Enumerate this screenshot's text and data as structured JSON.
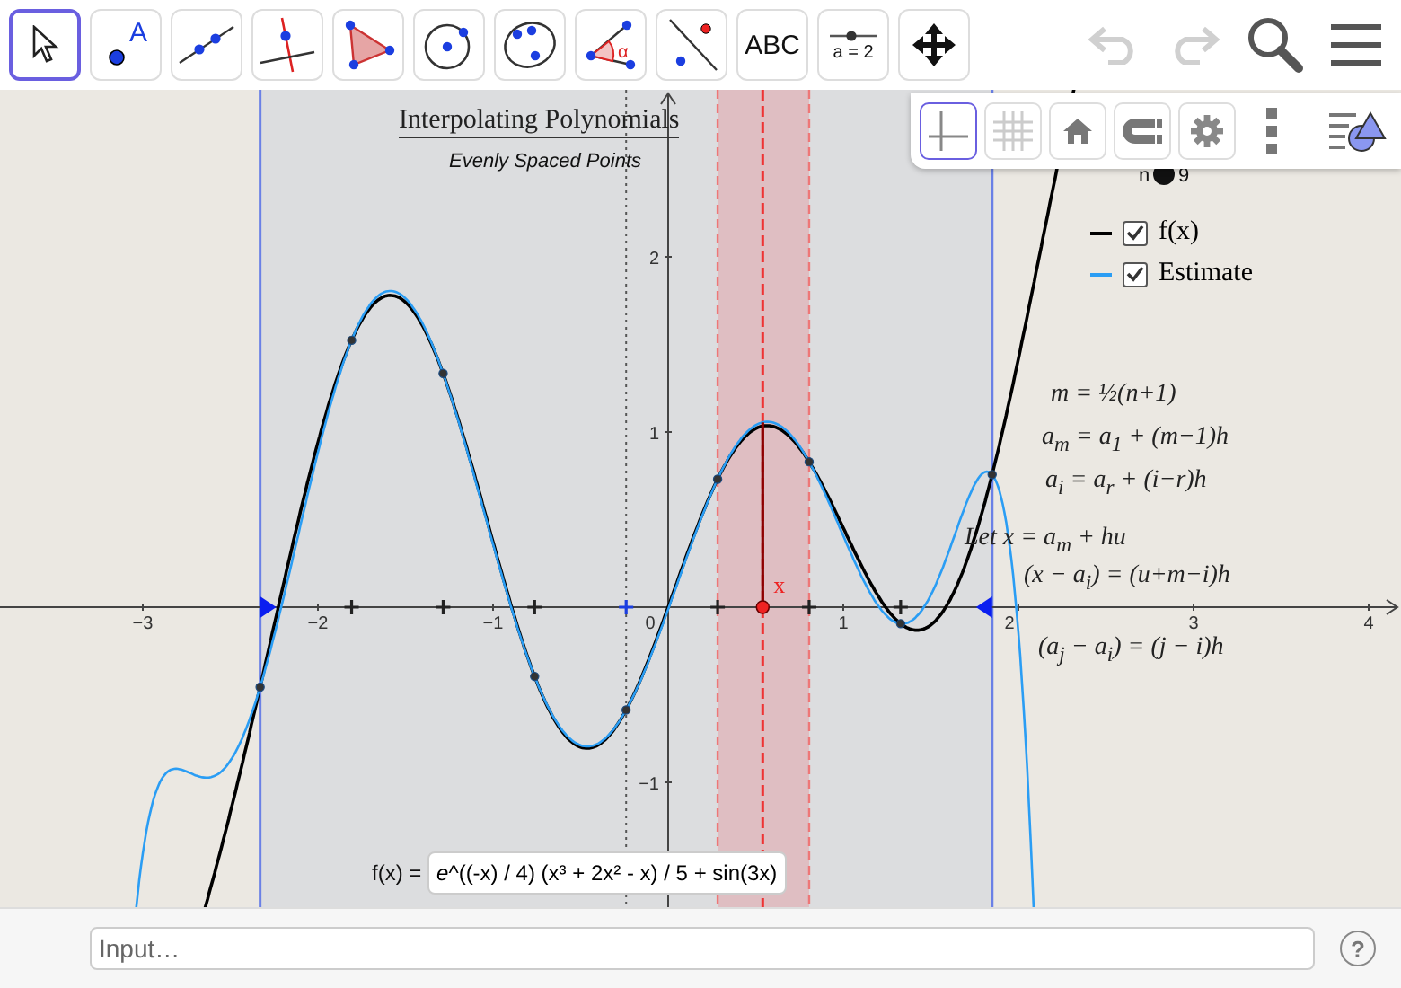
{
  "toolbar": {
    "tools": [
      {
        "kind": "move",
        "selected": true
      },
      {
        "kind": "point",
        "label": "A",
        "selected": false
      },
      {
        "kind": "line",
        "selected": false
      },
      {
        "kind": "perpendicular",
        "selected": false
      },
      {
        "kind": "polygon",
        "selected": false
      },
      {
        "kind": "circle",
        "selected": false
      },
      {
        "kind": "conic",
        "selected": false
      },
      {
        "kind": "angle",
        "label": "α",
        "selected": false
      },
      {
        "kind": "reflect",
        "selected": false
      },
      {
        "kind": "text",
        "label": "ABC",
        "selected": false
      },
      {
        "kind": "slider",
        "label": "a = 2",
        "selected": false
      },
      {
        "kind": "pan",
        "selected": false
      }
    ],
    "undo": {
      "disabled": true
    },
    "redo": {
      "disabled": true
    }
  },
  "graphics_style_bar": {
    "buttons": [
      {
        "kind": "axes",
        "on": true
      },
      {
        "kind": "grid",
        "on": false
      },
      {
        "kind": "home"
      },
      {
        "kind": "snap"
      },
      {
        "kind": "settings"
      },
      {
        "kind": "more"
      },
      {
        "kind": "style"
      }
    ]
  },
  "graphics": {
    "title": "Interpolating Polynomials",
    "subtitle": "Evenly Spaced Points",
    "slider": {
      "name": "n",
      "value": "9"
    },
    "legend": [
      {
        "label": "f(x)",
        "checked": true,
        "color": "#000000"
      },
      {
        "label": "Estimate",
        "checked": true,
        "color": "#2a9df4"
      }
    ],
    "formulas": [
      "m = ½(n+1)",
      "a$_{m}$ = a$_{1}$ + (m−1)h",
      "a$_{i}$ = a$_{r}$ + (i−r)h",
      "Let x = a$_{m}$ + hu",
      "(x − a$_{i}$) = (u+m−i)h",
      "(a$_{j}$ − a$_{i}$) = (j − i)h"
    ],
    "point_label": "x",
    "x_tick_labels": [
      "−3",
      "−2",
      "−1",
      "0",
      "1",
      "2",
      "3",
      "4"
    ],
    "y_tick_labels": [
      "2",
      "1",
      "−1"
    ],
    "function_input": {
      "label": "f(x) =",
      "value": "*e*^((-x) / 4) (x³ + 2x² - x) / 5 + sin(3x)"
    }
  },
  "input_bar": {
    "placeholder": "Input…",
    "help": "?"
  }
}
